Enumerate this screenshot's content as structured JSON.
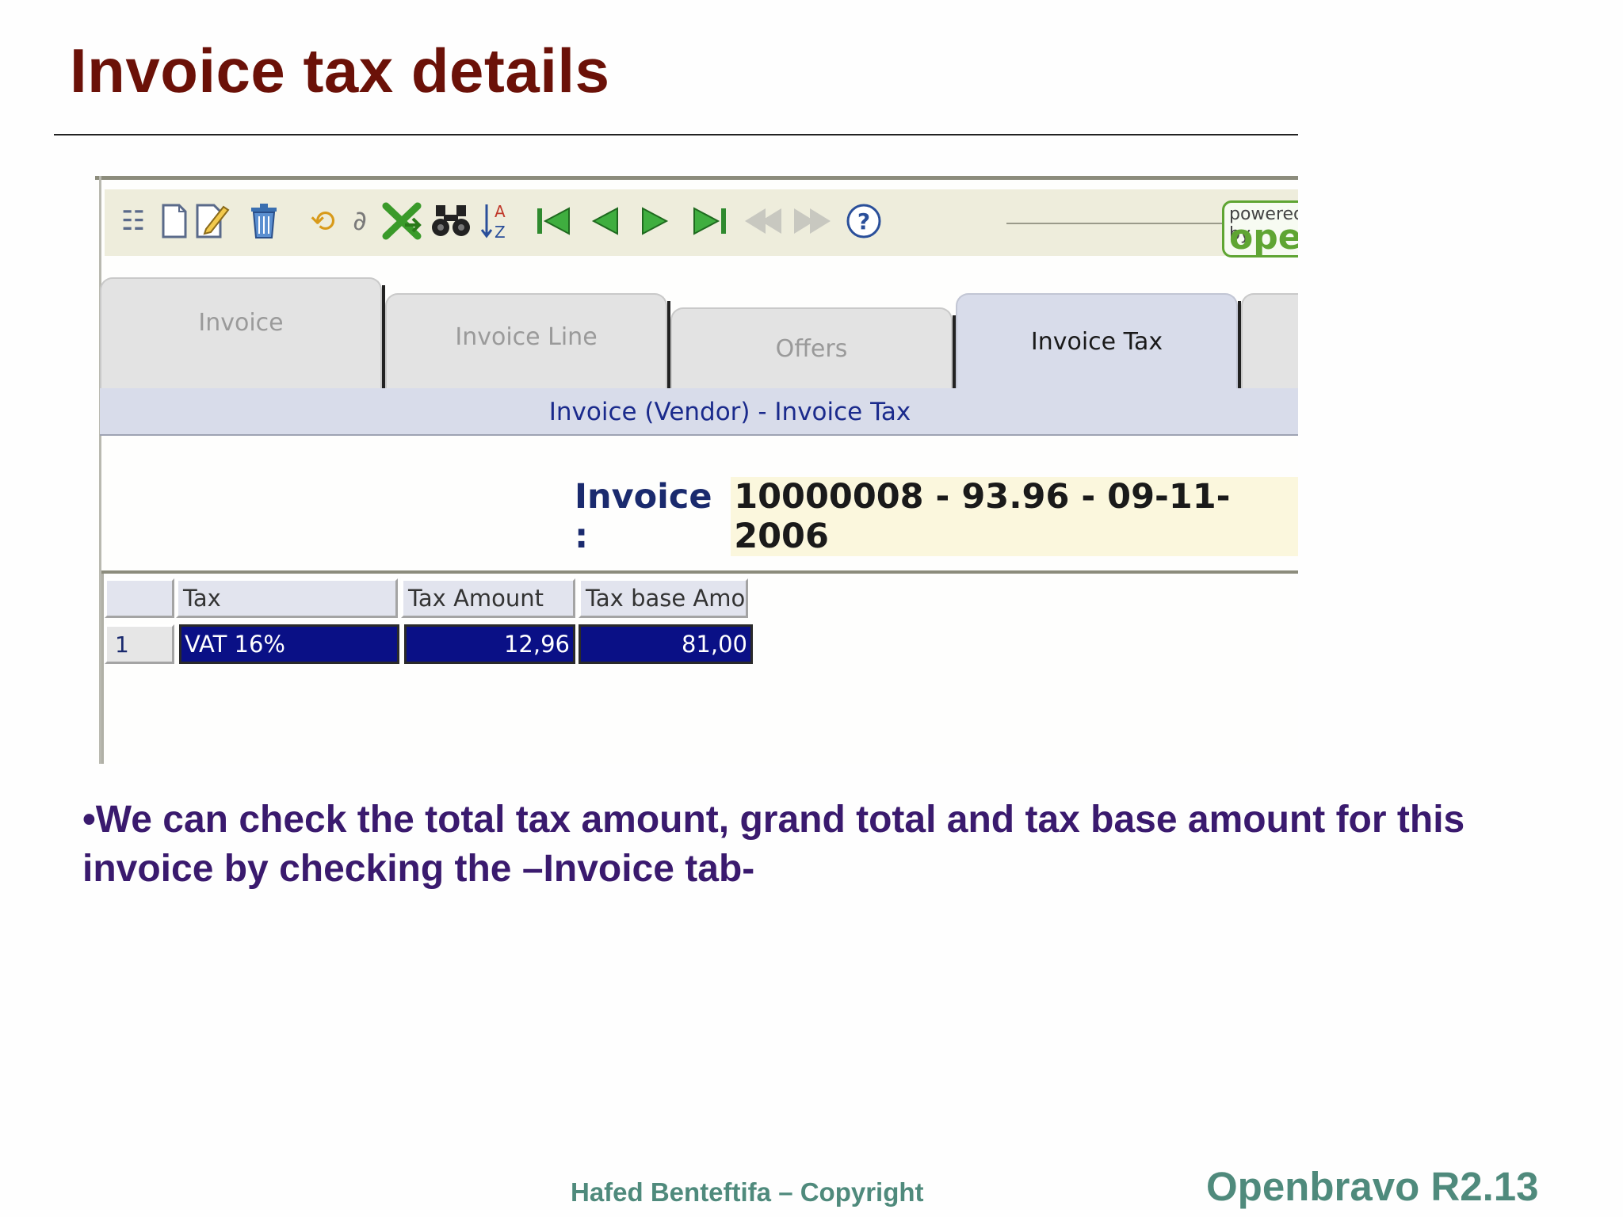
{
  "slide": {
    "title": "Invoice tax details",
    "bullet": "•We can check the total tax amount, grand total and tax base amount for this invoice by checking the –Invoice tab-",
    "footer_author": "Hafed Benteftifa – Copyright",
    "footer_version": "Openbravo R2.13"
  },
  "toolbar": {
    "icons": [
      "tree-icon",
      "new-record-icon",
      "edit-icon",
      "delete-icon",
      "refresh-icon",
      "attachment-icon",
      "export-icon",
      "search-icon",
      "sort-icon",
      "first-record-icon",
      "previous-record-icon",
      "next-record-icon",
      "last-record-icon",
      "previous-disabled-icon",
      "next-disabled-icon",
      "help-icon"
    ],
    "powered_text": "powered by",
    "logo_text": "open",
    "accent_color": "#5fa533"
  },
  "tabs": [
    {
      "label": "Invoice",
      "active": false
    },
    {
      "label": "Invoice Line",
      "active": false
    },
    {
      "label": "Offers",
      "active": false
    },
    {
      "label": "Invoice Tax",
      "active": true
    }
  ],
  "breadcrumb": "Invoice (Vendor) - Invoice Tax",
  "record": {
    "label": "Invoice :",
    "value": "10000008 - 93.96 - 09-11-2006"
  },
  "grid": {
    "columns": [
      "Tax",
      "Tax Amount",
      "Tax base Amo"
    ],
    "rows": [
      {
        "num": "1",
        "tax": "VAT 16%",
        "tax_amount": "12,96",
        "tax_base": "81,00"
      }
    ],
    "selected_color": "#0a1086"
  }
}
